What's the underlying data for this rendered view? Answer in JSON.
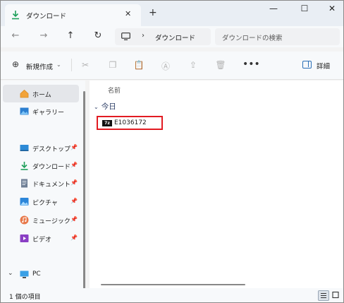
{
  "window": {
    "tab_title": "ダウンロード",
    "tab_close": "✕",
    "new_tab": "+",
    "minimize": "—",
    "maximize": "☐",
    "close": "✕"
  },
  "address": {
    "back": "←",
    "forward": "→",
    "up": "↑",
    "refresh": "↻",
    "separator": "›",
    "path": "ダウンロード",
    "search_placeholder": "ダウンロードの検索"
  },
  "toolbar": {
    "new_label": "新規作成",
    "new_dropdown": "⌄",
    "more": "•••",
    "details_label": "詳細",
    "icons": [
      "cut-icon",
      "copy-icon",
      "paste-icon",
      "rename-icon",
      "share-icon",
      "delete-icon"
    ]
  },
  "sidebar": {
    "items": [
      {
        "label": "ホーム",
        "icon": "home-icon",
        "selected": true
      },
      {
        "label": "ギャラリー",
        "icon": "gallery-icon"
      },
      {
        "label": "デスクトップ",
        "icon": "desktop-icon",
        "pinned": true
      },
      {
        "label": "ダウンロード",
        "icon": "download-icon",
        "pinned": true
      },
      {
        "label": "ドキュメント",
        "icon": "documents-icon",
        "pinned": true
      },
      {
        "label": "ピクチャ",
        "icon": "pictures-icon",
        "pinned": true
      },
      {
        "label": "ミュージック",
        "icon": "music-icon",
        "pinned": true
      },
      {
        "label": "ビデオ",
        "icon": "video-icon",
        "pinned": true
      },
      {
        "label": "PC",
        "icon": "pc-icon",
        "expand": "⌄"
      }
    ],
    "pin_glyph": "📌"
  },
  "main": {
    "column_header": "名前",
    "group_label": "今日",
    "group_chevron": "⌄",
    "files": [
      {
        "name": "E1036172",
        "icon": "7z-archive-icon",
        "icon_text": "7z"
      }
    ]
  },
  "status": {
    "item_count": "1 個の項目"
  },
  "colors": {
    "accent": "#2a6fb7",
    "highlight_border": "#e21b22",
    "download_green": "#1e9f5a"
  }
}
